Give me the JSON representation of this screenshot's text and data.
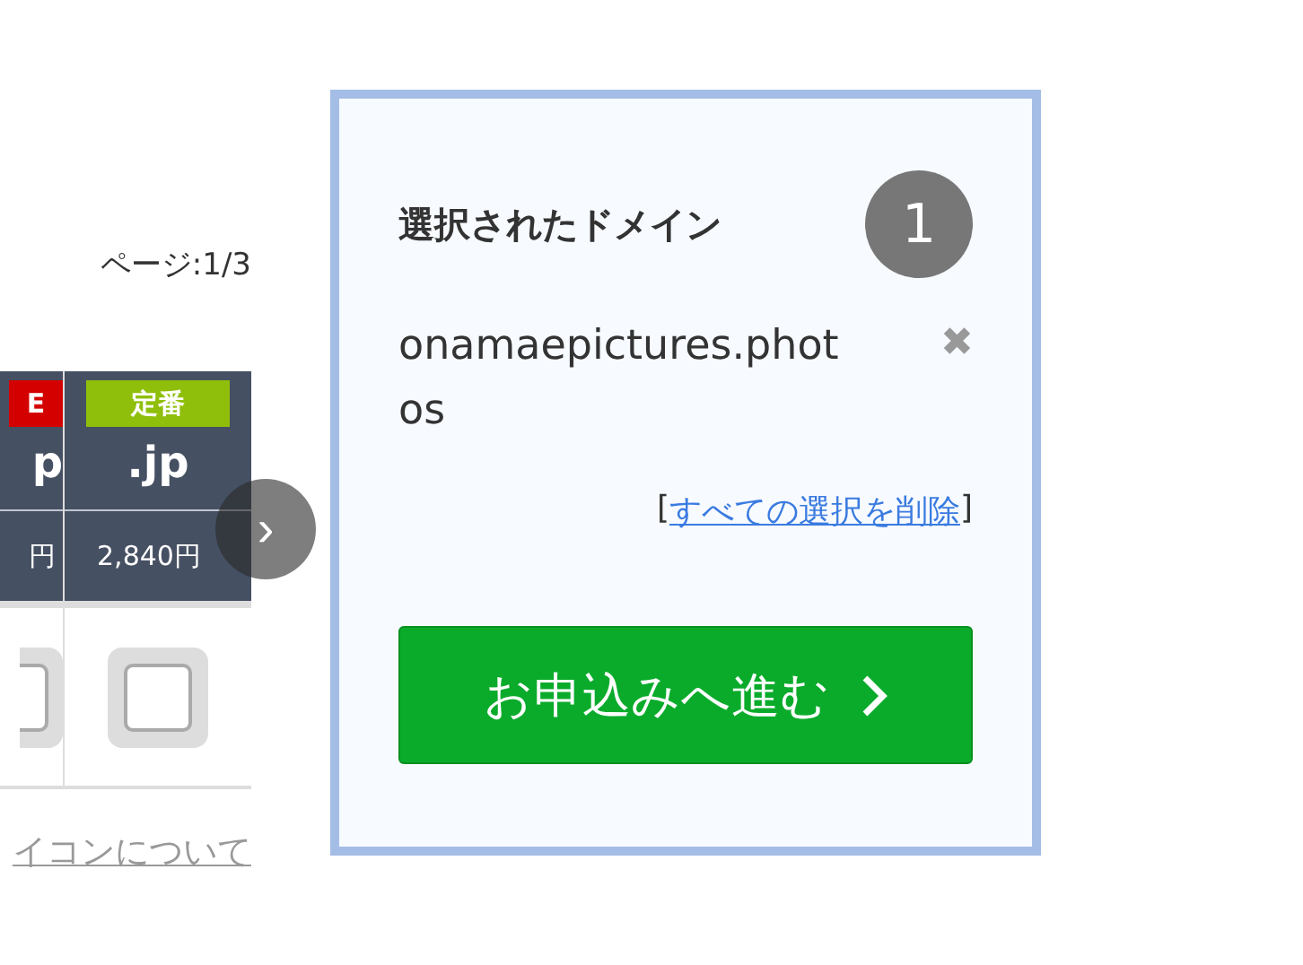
{
  "pager": {
    "label": "ページ:1/3"
  },
  "columns": [
    {
      "badge": "E",
      "color": "#d40000",
      "tld": "p",
      "price": "円",
      "checked": false
    },
    {
      "badge": "定番",
      "color": "#8fbf0a",
      "tld": ".jp",
      "price": "2,840円",
      "checked": false
    }
  ],
  "next_button": {
    "label": "›"
  },
  "footer_link": "イコンについて",
  "selection": {
    "title": "選択されたドメイン",
    "count": "1",
    "domains": [
      {
        "name": "onamaepictures.photos",
        "remove": "✖"
      }
    ],
    "clear_open": "[",
    "clear_link": "すべての選択を削除",
    "clear_close": "]",
    "submit": "お申込みへ進む"
  }
}
